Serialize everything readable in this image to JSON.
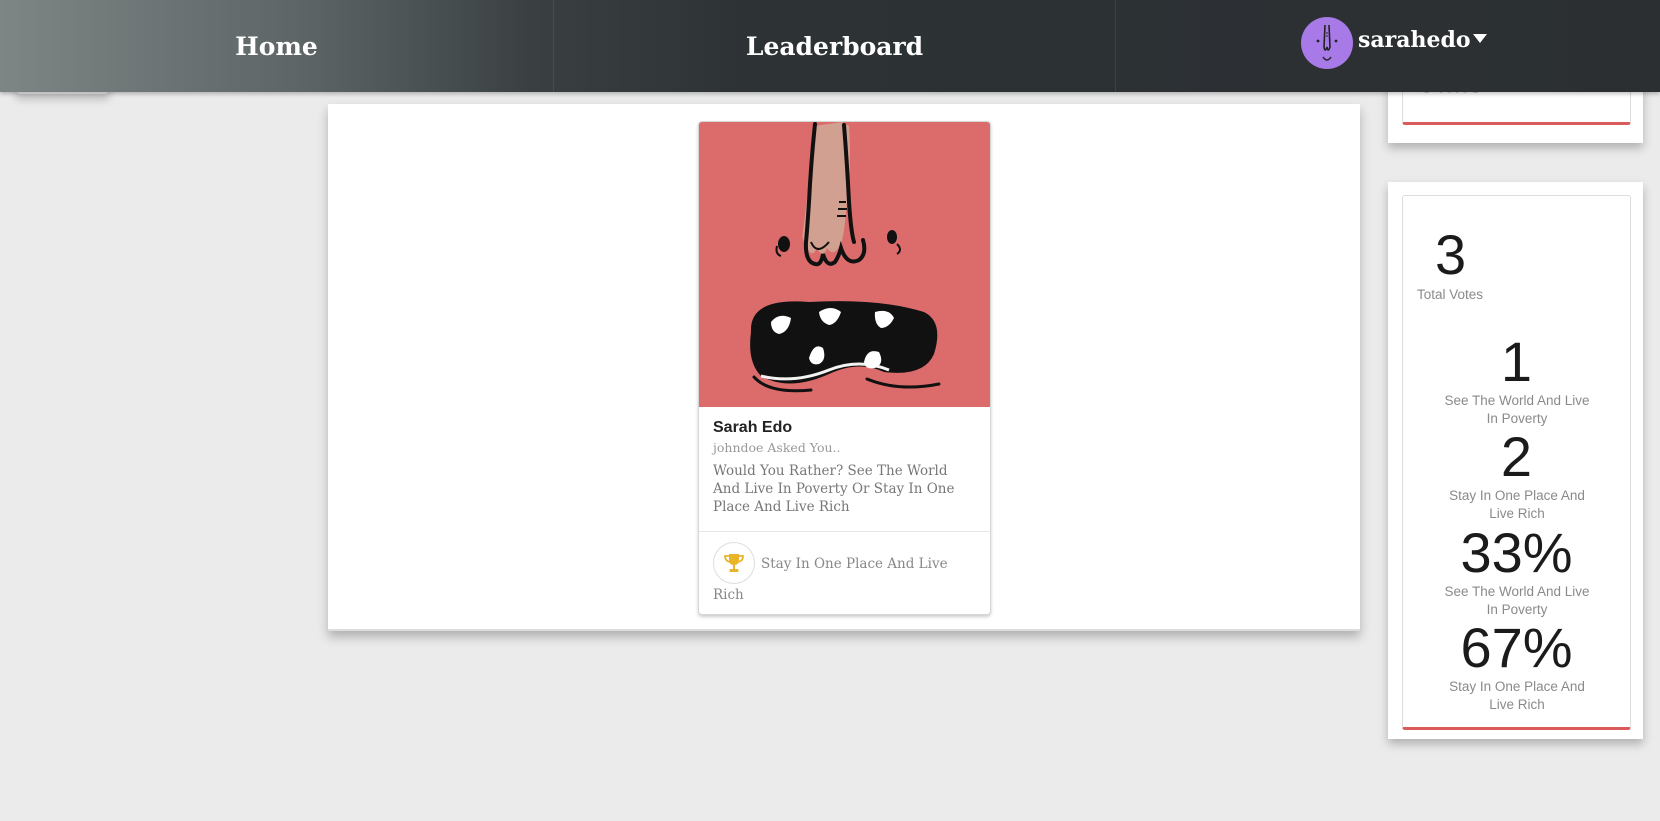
{
  "nav": {
    "home_label": "Home",
    "leaderboard_label": "Leaderboard",
    "username": "sarahedo"
  },
  "card": {
    "name": "Sarah Edo",
    "meta": "johndoe Asked You..",
    "question": "Would You Rather? See The World And Live In Poverty Or Stay In One Place And Live Rich",
    "answer": "Stay In One Place And Live Rich",
    "image_bg_color": "#dc6c6c"
  },
  "stats": {
    "title": "Stats",
    "total_votes": "3",
    "total_votes_label": "Total Votes",
    "option_one_votes": "1",
    "option_one_label": "See The World And Live In Poverty",
    "option_two_votes": "2",
    "option_two_label": "Stay In One Place And Live Rich",
    "option_one_percent": "33%",
    "option_one_percent_label": "See The World And Live In Poverty",
    "option_two_percent": "67%",
    "option_two_percent_label": "Stay In One Place And Live Rich",
    "accent_color": "#db5a5a"
  }
}
